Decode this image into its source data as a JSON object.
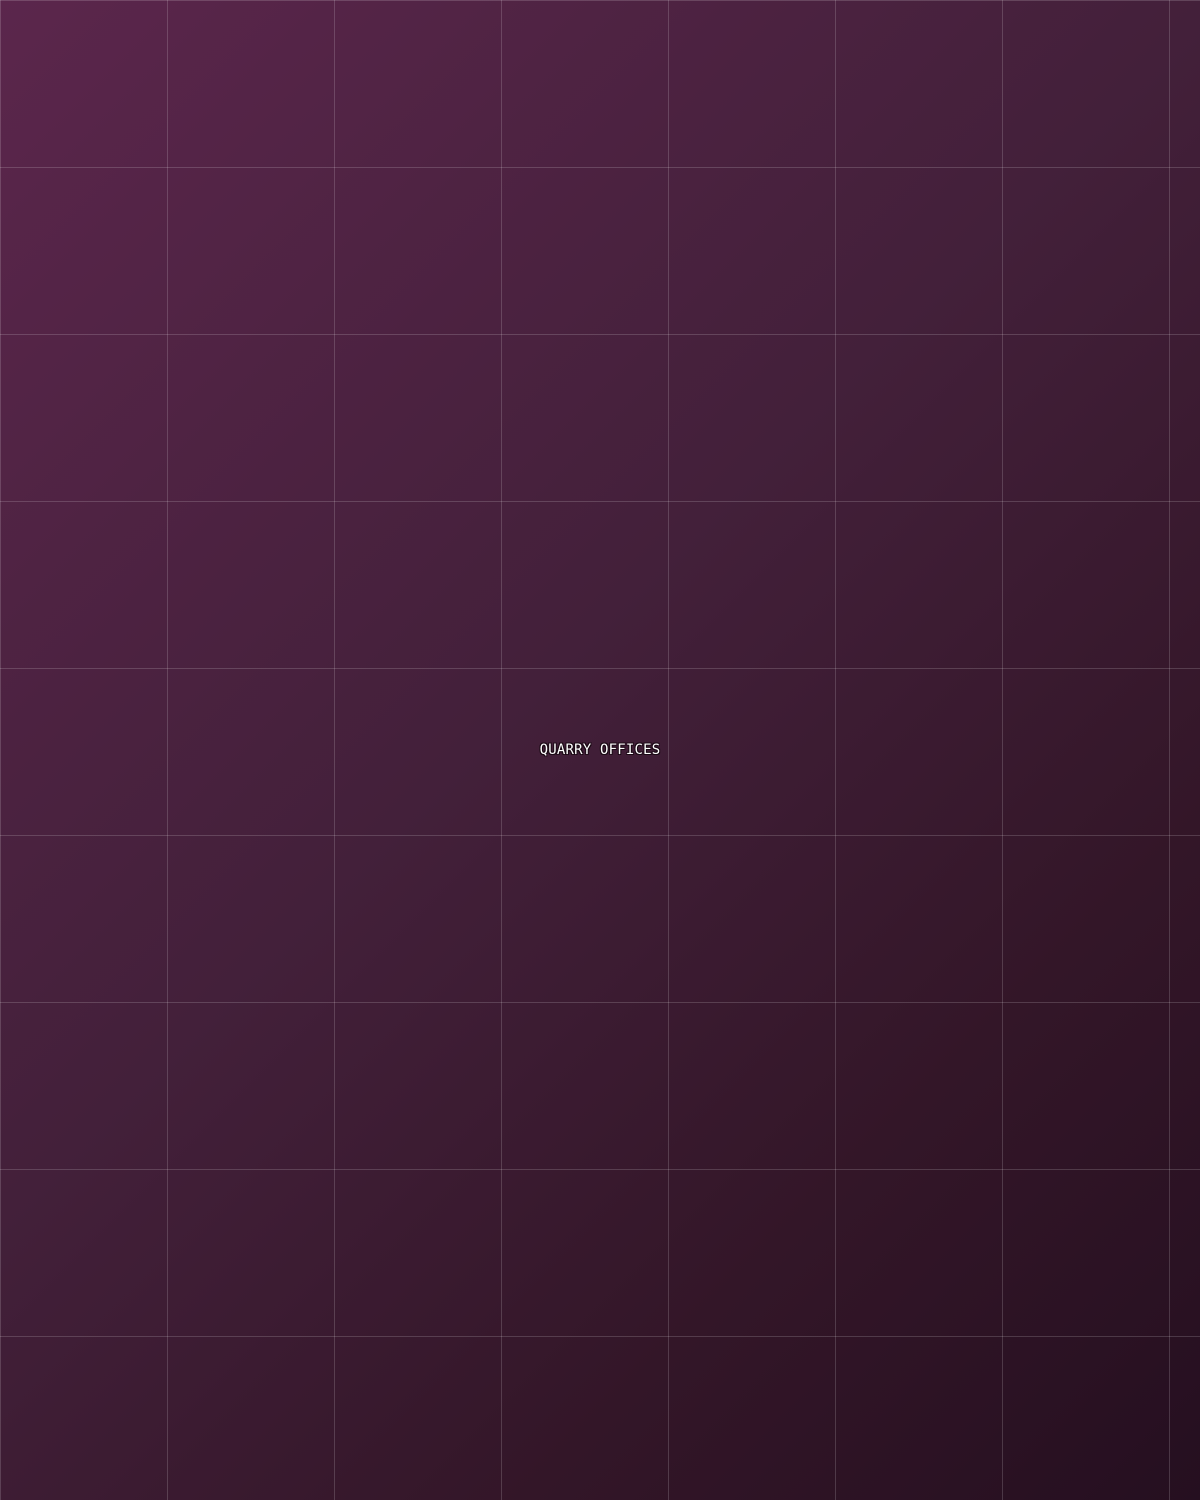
{
  "map": {
    "location_label": "QUARRY OFFICES"
  },
  "colors": {
    "background_start": "#5b264c",
    "background_end": "#250f20",
    "grid_line": "rgba(255,255,255,0.16)",
    "label_text": "#ffffff"
  }
}
